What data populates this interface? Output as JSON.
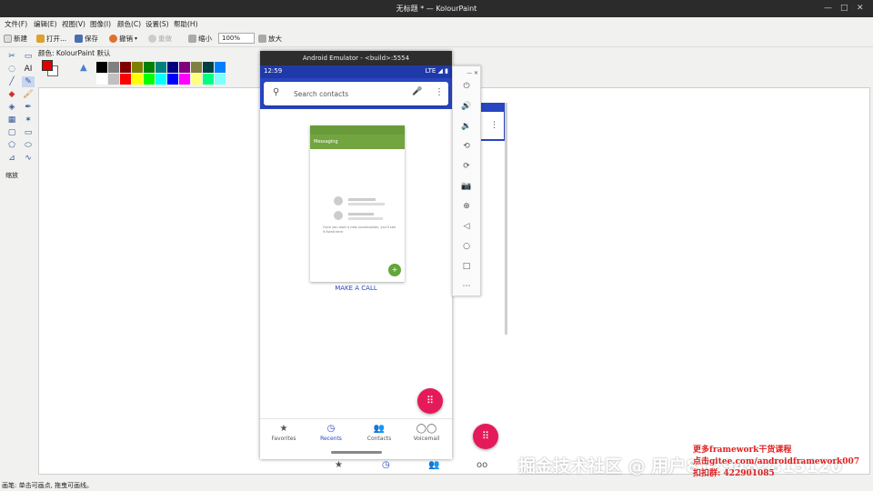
{
  "window": {
    "title": "无标题 * — KolourPaint"
  },
  "menu": {
    "items": [
      "文件(F)",
      "编辑(E)",
      "视图(V)",
      "图像(I)",
      "颜色(C)",
      "设置(S)",
      "帮助(H)"
    ]
  },
  "toolbar": {
    "new_label": "新建",
    "open_label": "打开...",
    "save_label": "保存",
    "undo_label": "撤销",
    "redo_label": "重做",
    "zoom_out_label": "缩小",
    "zoom_value": "100%",
    "zoom_in_label": "放大"
  },
  "colorbar": {
    "label": "颜色: KolourPaint 默认",
    "foreground": "#e00000",
    "background": "#ffffff",
    "palette": [
      "#000000",
      "#808080",
      "#800000",
      "#808000",
      "#008000",
      "#008080",
      "#000080",
      "#800080",
      "#808040",
      "#004040",
      "#0080ff",
      "#ffffff",
      "#c0c0c0",
      "#ff0000",
      "#ffff00",
      "#00ff00",
      "#00ffff",
      "#0000ff",
      "#ff00ff",
      "#ffff80",
      "#00ff80",
      "#80ffff"
    ]
  },
  "tools": {
    "zoom_label": "缩放"
  },
  "status": {
    "text": "画笔: 单击可画点, 拖曳可画线。"
  },
  "emulator": {
    "title": "Android Emulator - <build>:5554",
    "status_time": "12:59",
    "status_right": "LTE ◢ ▮",
    "search_placeholder": "Search contacts",
    "thumbnail_title": "Messaging",
    "thumbnail_body": "Once you start a new conversation, you'll see it listed here",
    "make_call": "MAKE A CALL",
    "nav": [
      {
        "label": "Favorites",
        "icon": "★"
      },
      {
        "label": "Recents",
        "icon": "◷"
      },
      {
        "label": "Contacts",
        "icon": "👥"
      },
      {
        "label": "Voicemail",
        "icon": "◯◯"
      }
    ]
  },
  "overlay": {
    "watermark": "掘金技术社区 @ 用户8129482815120",
    "promo_line1": "更多framework干货课程",
    "promo_line2": "点击gitee.com/androidframework007",
    "promo_line3": "扣扣群: 422901085"
  }
}
